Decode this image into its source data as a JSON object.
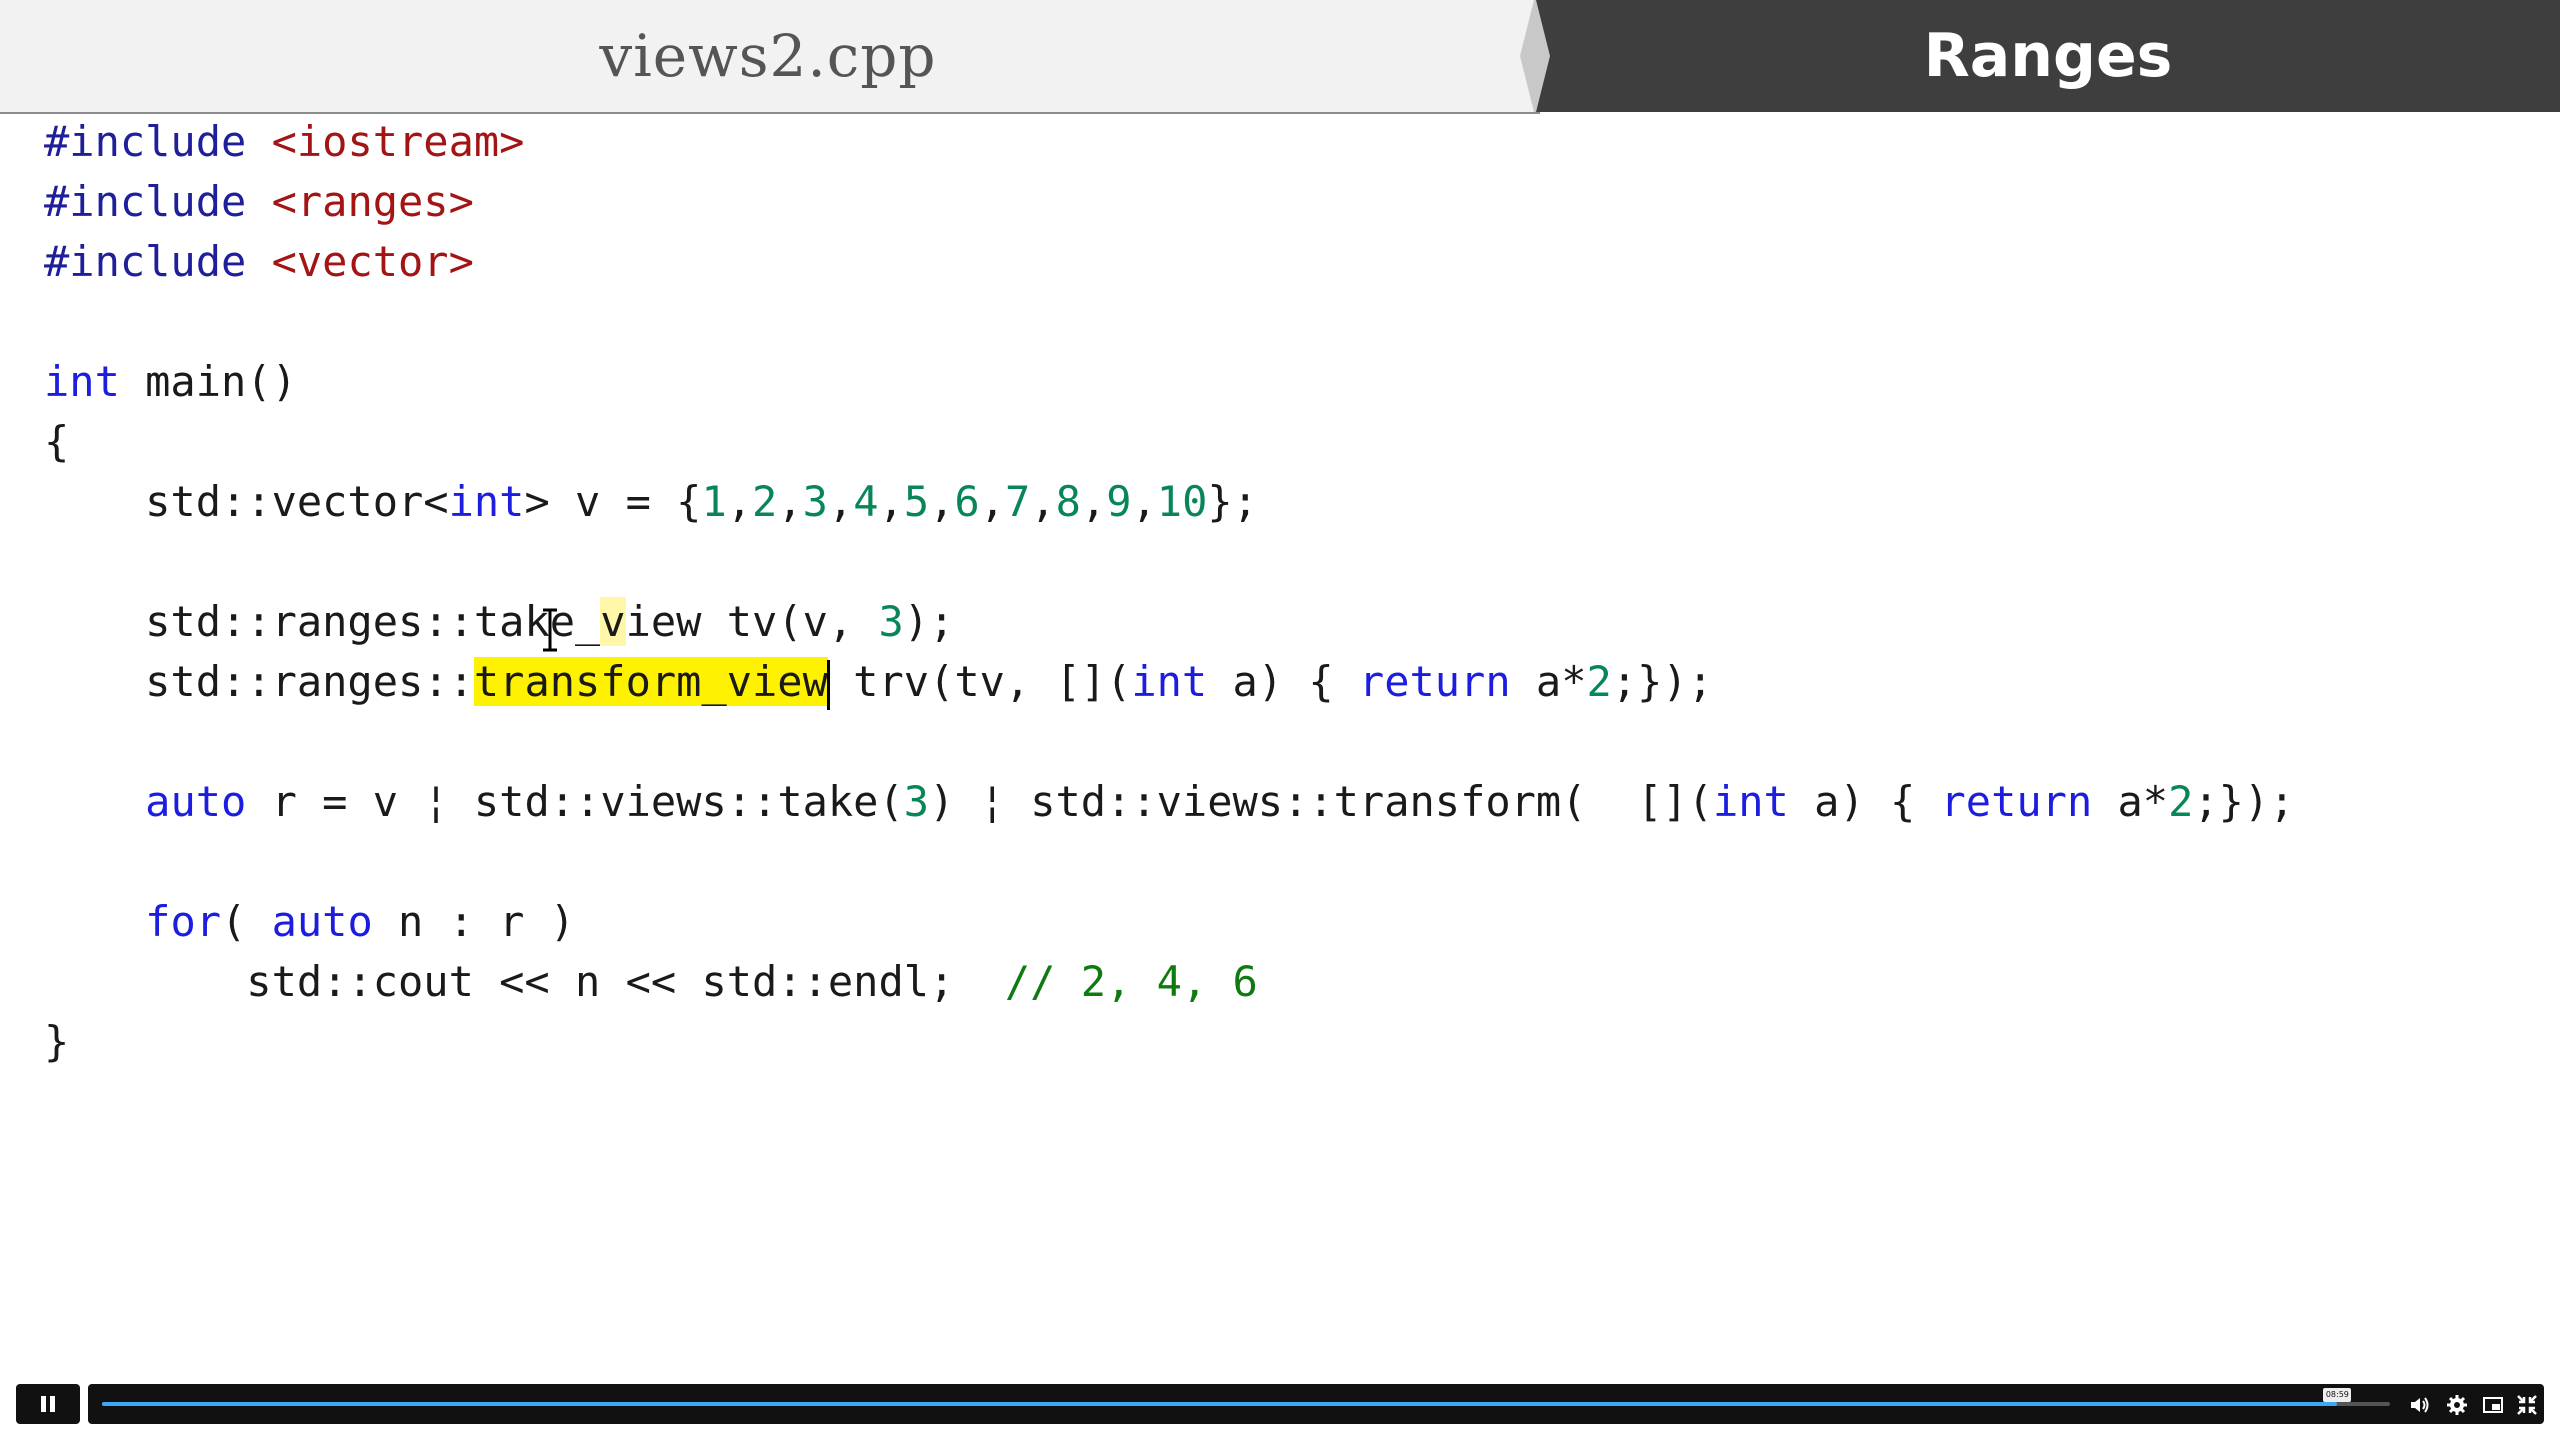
{
  "header": {
    "file_name": "views2.cpp",
    "topic": "Ranges"
  },
  "code": {
    "l1": {
      "a": "#include",
      "b": "<iostream>"
    },
    "l2": {
      "a": "#include",
      "b": "<ranges>"
    },
    "l3": {
      "a": "#include",
      "b": "<vector>"
    },
    "l5": {
      "a": "int",
      "b": " main()"
    },
    "l6": "{",
    "l7": {
      "a": "    std::vector<",
      "b": "int",
      "c": "> v = {",
      "n": [
        "1",
        "2",
        "3",
        "4",
        "5",
        "6",
        "7",
        "8",
        "9",
        "10"
      ],
      "sep": ",",
      "end": "};"
    },
    "l9": {
      "a": "    std::ranges::take_",
      "b": "v",
      "c": "iew tv(v, ",
      "d": "3",
      "e": ");"
    },
    "l10": {
      "a": "    std::ranges::",
      "b": "transform_view",
      "c": " trv(tv, [](",
      "d": "int",
      "e": " a) { ",
      "f": "return",
      "g": " a*",
      "h": "2",
      "i": ";});"
    },
    "l12": {
      "a": "auto",
      "b": " r = v ¦ std::views::take(",
      "c": "3",
      "d": ") ¦ std::views::transform(  [](",
      "e": "int",
      "f": " a) { ",
      "g": "return",
      "h": " a*",
      "i": "2",
      "j": ";});"
    },
    "l14": {
      "a": "for",
      "b": "( ",
      "c": "auto",
      "d": " n : r )"
    },
    "l15": {
      "a": "        std::cout << n << std::endl;  ",
      "b": "// 2, 4, 6"
    },
    "l16": "}"
  },
  "player": {
    "progress_fraction": 0.977,
    "time_tooltip": "08:59",
    "colors": {
      "progress": "#3ea6f7",
      "bar": "#111111"
    },
    "icons": [
      "pause-icon",
      "volume-icon",
      "gear-icon",
      "pip-icon",
      "exit-fullscreen-icon"
    ]
  }
}
